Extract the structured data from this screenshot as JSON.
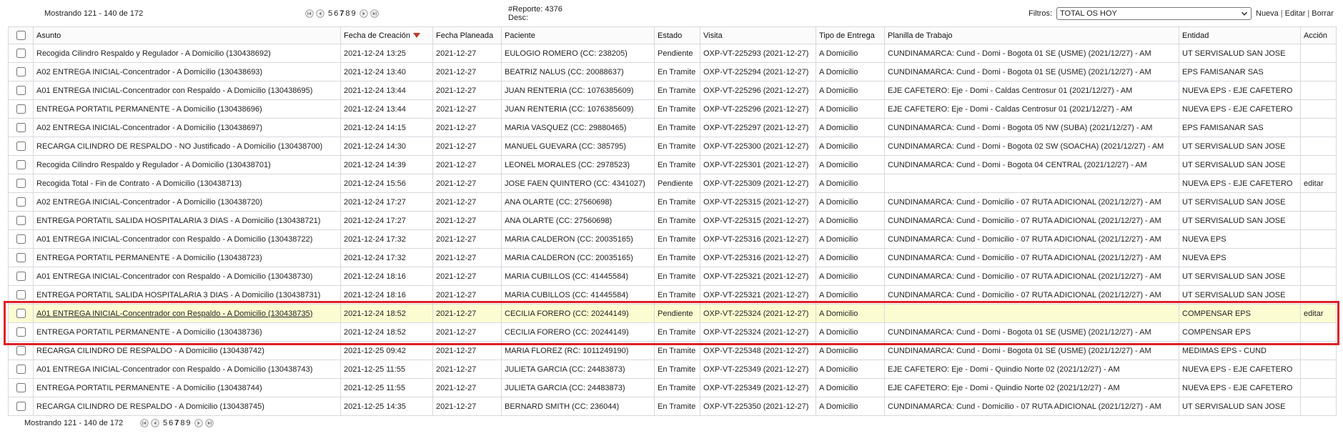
{
  "header_bar": {
    "showing_text": "Mostrando 121 - 140 de 172",
    "pages": [
      "5",
      "6",
      "7",
      "8",
      "9"
    ],
    "current_page": 7,
    "report_label": "#Reporte: 4376",
    "desc_label": "Desc:",
    "filters_label": "Filtros:",
    "filter_selected": "TOTAL OS HOY",
    "actions": [
      "Nueva",
      "Editar",
      "Borrar"
    ],
    "action_separator": "|"
  },
  "footer_bar": {
    "showing_text": "Mostrando 121 - 140 de 172",
    "pages": [
      "5",
      "6",
      "7",
      "8",
      "9"
    ],
    "current_page": 7
  },
  "icons": {
    "first": "first-page-icon",
    "previous": "previous-page-icon",
    "next": "next-page-icon",
    "last": "last-page-icon",
    "select": "chevron-down-icon",
    "sort": "sort-desc-icon"
  },
  "colors": {
    "grid_border": "#d5d8de",
    "hover_row": "#fcfcd2",
    "annotation_red": "#e02027",
    "sort_arrow": "#c0392b",
    "text": "#222222"
  },
  "table": {
    "columns": [
      "Asunto",
      "Fecha de Creación",
      "Fecha Planeada",
      "Paciente",
      "Estado",
      "Visita",
      "Tipo de Entrega",
      "Planilla de Trabajo",
      "Entidad",
      "Acción"
    ],
    "rows": [
      {
        "asunto": "Recogida Cilindro Respaldo y Regulador - A Domicilio (130438692)",
        "fecha_creacion": "2021-12-24 13:25",
        "fecha_planeada": "2021-12-27",
        "paciente": "EULOGIO ROMERO (CC: 238205)",
        "estado": "Pendiente",
        "visita": "OXP-VT-225293 (2021-12-27)",
        "tipo_entrega": "A Domicilio",
        "planilla": "CUNDINAMARCA: Cund - Domi - Bogota 01 SE (USME) (2021/12/27) - AM",
        "entidad": "UT SERVISALUD SAN JOSE",
        "accion": ""
      },
      {
        "asunto": "A02 ENTREGA INICIAL-Concentrador - A Domicilio (130438693)",
        "fecha_creacion": "2021-12-24 13:40",
        "fecha_planeada": "2021-12-27",
        "paciente": "BEATRIZ NALUS (CC: 20088637)",
        "estado": "En Tramite",
        "visita": "OXP-VT-225294 (2021-12-27)",
        "tipo_entrega": "A Domicilio",
        "planilla": "CUNDINAMARCA: Cund - Domi - Bogota 01 SE (USME) (2021/12/27) - AM",
        "entidad": "EPS FAMISANAR SAS",
        "accion": ""
      },
      {
        "asunto": "A01 ENTREGA INICIAL-Concentrador con Respaldo - A Domicilio (130438695)",
        "fecha_creacion": "2021-12-24 13:44",
        "fecha_planeada": "2021-12-27",
        "paciente": "JUAN RENTERIA (CC: 1076385609)",
        "estado": "En Tramite",
        "visita": "OXP-VT-225296 (2021-12-27)",
        "tipo_entrega": "A Domicilio",
        "planilla": "EJE CAFETERO: Eje - Domi - Caldas Centrosur 01 (2021/12/27) - AM",
        "entidad": "NUEVA EPS - EJE CAFETERO",
        "accion": ""
      },
      {
        "asunto": "ENTREGA PORTATIL PERMANENTE - A Domicilio (130438696)",
        "fecha_creacion": "2021-12-24 13:44",
        "fecha_planeada": "2021-12-27",
        "paciente": "JUAN RENTERIA (CC: 1076385609)",
        "estado": "En Tramite",
        "visita": "OXP-VT-225296 (2021-12-27)",
        "tipo_entrega": "A Domicilio",
        "planilla": "EJE CAFETERO: Eje - Domi - Caldas Centrosur 01 (2021/12/27) - AM",
        "entidad": "NUEVA EPS - EJE CAFETERO",
        "accion": ""
      },
      {
        "asunto": "A02 ENTREGA INICIAL-Concentrador - A Domicilio (130438697)",
        "fecha_creacion": "2021-12-24 14:15",
        "fecha_planeada": "2021-12-27",
        "paciente": "MARIA VASQUEZ (CC: 29880465)",
        "estado": "En Tramite",
        "visita": "OXP-VT-225297 (2021-12-27)",
        "tipo_entrega": "A Domicilio",
        "planilla": "CUNDINAMARCA: Cund - Domi - Bogota 05 NW (SUBA) (2021/12/27) - AM",
        "entidad": "EPS FAMISANAR SAS",
        "accion": ""
      },
      {
        "asunto": "RECARGA CILINDRO DE RESPALDO - NO Justificado - A Domicilio (130438700)",
        "fecha_creacion": "2021-12-24 14:30",
        "fecha_planeada": "2021-12-27",
        "paciente": "MANUEL GUEVARA (CC: 385795)",
        "estado": "En Tramite",
        "visita": "OXP-VT-225300 (2021-12-27)",
        "tipo_entrega": "A Domicilio",
        "planilla": "CUNDINAMARCA: Cund - Domi - Bogota 02 SW (SOACHA) (2021/12/27) - AM",
        "entidad": "UT SERVISALUD SAN JOSE",
        "accion": ""
      },
      {
        "asunto": "Recogida Cilindro Respaldo y Regulador - A Domicilio (130438701)",
        "fecha_creacion": "2021-12-24 14:39",
        "fecha_planeada": "2021-12-27",
        "paciente": "LEONEL MORALES (CC: 2978523)",
        "estado": "En Tramite",
        "visita": "OXP-VT-225301 (2021-12-27)",
        "tipo_entrega": "A Domicilio",
        "planilla": "CUNDINAMARCA: Cund - Domi - Bogota 04 CENTRAL (2021/12/27) - AM",
        "entidad": "UT SERVISALUD SAN JOSE",
        "accion": ""
      },
      {
        "asunto": "Recogida Total - Fin de Contrato - A Domicilio (130438713)",
        "fecha_creacion": "2021-12-24 15:56",
        "fecha_planeada": "2021-12-27",
        "paciente": "JOSE FAEN QUINTERO (CC: 4341027)",
        "estado": "Pendiente",
        "visita": "OXP-VT-225309 (2021-12-27)",
        "tipo_entrega": "A Domicilio",
        "planilla": "",
        "entidad": "NUEVA EPS - EJE CAFETERO",
        "accion": "editar"
      },
      {
        "asunto": "A02 ENTREGA INICIAL-Concentrador - A Domicilio (130438720)",
        "fecha_creacion": "2021-12-24 17:27",
        "fecha_planeada": "2021-12-27",
        "paciente": "ANA OLARTE (CC: 27560698)",
        "estado": "En Tramite",
        "visita": "OXP-VT-225315 (2021-12-27)",
        "tipo_entrega": "A Domicilio",
        "planilla": "CUNDINAMARCA: Cund - Domicilio - 07 RUTA ADICIONAL (2021/12/27) - AM",
        "entidad": "UT SERVISALUD SAN JOSE",
        "accion": ""
      },
      {
        "asunto": "ENTREGA PORTATIL SALIDA HOSPITALARIA 3 DIAS - A Domicilio (130438721)",
        "fecha_creacion": "2021-12-24 17:27",
        "fecha_planeada": "2021-12-27",
        "paciente": "ANA OLARTE (CC: 27560698)",
        "estado": "En Tramite",
        "visita": "OXP-VT-225315 (2021-12-27)",
        "tipo_entrega": "A Domicilio",
        "planilla": "CUNDINAMARCA: Cund - Domicilio - 07 RUTA ADICIONAL (2021/12/27) - AM",
        "entidad": "UT SERVISALUD SAN JOSE",
        "accion": ""
      },
      {
        "asunto": "A01 ENTREGA INICIAL-Concentrador con Respaldo - A Domicilio (130438722)",
        "fecha_creacion": "2021-12-24 17:32",
        "fecha_planeada": "2021-12-27",
        "paciente": "MARIA CALDERON (CC: 20035165)",
        "estado": "En Tramite",
        "visita": "OXP-VT-225316 (2021-12-27)",
        "tipo_entrega": "A Domicilio",
        "planilla": "CUNDINAMARCA: Cund - Domicilio - 07 RUTA ADICIONAL (2021/12/27) - AM",
        "entidad": "NUEVA EPS",
        "accion": ""
      },
      {
        "asunto": "ENTREGA PORTATIL PERMANENTE - A Domicilio (130438723)",
        "fecha_creacion": "2021-12-24 17:32",
        "fecha_planeada": "2021-12-27",
        "paciente": "MARIA CALDERON (CC: 20035165)",
        "estado": "En Tramite",
        "visita": "OXP-VT-225316 (2021-12-27)",
        "tipo_entrega": "A Domicilio",
        "planilla": "CUNDINAMARCA: Cund - Domicilio - 07 RUTA ADICIONAL (2021/12/27) - AM",
        "entidad": "NUEVA EPS",
        "accion": ""
      },
      {
        "asunto": "A01 ENTREGA INICIAL-Concentrador con Respaldo - A Domicilio (130438730)",
        "fecha_creacion": "2021-12-24 18:16",
        "fecha_planeada": "2021-12-27",
        "paciente": "MARIA CUBILLOS (CC: 41445584)",
        "estado": "En Tramite",
        "visita": "OXP-VT-225321 (2021-12-27)",
        "tipo_entrega": "A Domicilio",
        "planilla": "CUNDINAMARCA: Cund - Domicilio - 07 RUTA ADICIONAL (2021/12/27) - AM",
        "entidad": "UT SERVISALUD SAN JOSE",
        "accion": ""
      },
      {
        "asunto": "ENTREGA PORTATIL SALIDA HOSPITALARIA 3 DIAS - A Domicilio (130438731)",
        "fecha_creacion": "2021-12-24 18:16",
        "fecha_planeada": "2021-12-27",
        "paciente": "MARIA CUBILLOS (CC: 41445584)",
        "estado": "En Tramite",
        "visita": "OXP-VT-225321 (2021-12-27)",
        "tipo_entrega": "A Domicilio",
        "planilla": "CUNDINAMARCA: Cund - Domicilio - 07 RUTA ADICIONAL (2021/12/27) - AM",
        "entidad": "UT SERVISALUD SAN JOSE",
        "accion": ""
      },
      {
        "asunto": "A01 ENTREGA INICIAL-Concentrador con Respaldo - A Domicilio (130438735)",
        "fecha_creacion": "2021-12-24 18:52",
        "fecha_planeada": "2021-12-27",
        "paciente": "CECILIA FORERO (CC: 20244149)",
        "estado": "Pendiente",
        "visita": "OXP-VT-225324 (2021-12-27)",
        "tipo_entrega": "A Domicilio",
        "planilla": "",
        "entidad": "COMPENSAR EPS",
        "accion": "editar",
        "highlighted": true
      },
      {
        "asunto": "ENTREGA PORTATIL PERMANENTE - A Domicilio (130438736)",
        "fecha_creacion": "2021-12-24 18:52",
        "fecha_planeada": "2021-12-27",
        "paciente": "CECILIA FORERO (CC: 20244149)",
        "estado": "En Tramite",
        "visita": "OXP-VT-225324 (2021-12-27)",
        "tipo_entrega": "A Domicilio",
        "planilla": "CUNDINAMARCA: Cund - Domi - Bogota 01 SE (USME) (2021/12/27) - AM",
        "entidad": "COMPENSAR EPS",
        "accion": ""
      },
      {
        "asunto": "RECARGA CILINDRO DE RESPALDO - A Domicilio (130438742)",
        "fecha_creacion": "2021-12-25 09:42",
        "fecha_planeada": "2021-12-27",
        "paciente": "MARIA FLOREZ (RC: 1011249190)",
        "estado": "En Tramite",
        "visita": "OXP-VT-225348 (2021-12-27)",
        "tipo_entrega": "A Domicilio",
        "planilla": "CUNDINAMARCA: Cund - Domi - Bogota 01 SE (USME) (2021/12/27) - AM",
        "entidad": "MEDIMAS EPS - CUND",
        "accion": ""
      },
      {
        "asunto": "A01 ENTREGA INICIAL-Concentrador con Respaldo - A Domicilio (130438743)",
        "fecha_creacion": "2021-12-25 11:55",
        "fecha_planeada": "2021-12-27",
        "paciente": "JULIETA GARCIA (CC: 24483873)",
        "estado": "En Tramite",
        "visita": "OXP-VT-225349 (2021-12-27)",
        "tipo_entrega": "A Domicilio",
        "planilla": "EJE CAFETERO: Eje - Domi - Quindio Norte 02 (2021/12/27) - AM",
        "entidad": "NUEVA EPS - EJE CAFETERO",
        "accion": ""
      },
      {
        "asunto": "ENTREGA PORTATIL PERMANENTE - A Domicilio (130438744)",
        "fecha_creacion": "2021-12-25 11:55",
        "fecha_planeada": "2021-12-27",
        "paciente": "JULIETA GARCIA (CC: 24483873)",
        "estado": "En Tramite",
        "visita": "OXP-VT-225349 (2021-12-27)",
        "tipo_entrega": "A Domicilio",
        "planilla": "EJE CAFETERO: Eje - Domi - Quindio Norte 02 (2021/12/27) - AM",
        "entidad": "NUEVA EPS - EJE CAFETERO",
        "accion": ""
      },
      {
        "asunto": "RECARGA CILINDRO DE RESPALDO - A Domicilio (130438745)",
        "fecha_creacion": "2021-12-25 14:35",
        "fecha_planeada": "2021-12-27",
        "paciente": "BERNARD SMITH (CC: 236044)",
        "estado": "En Tramite",
        "visita": "OXP-VT-225350 (2021-12-27)",
        "tipo_entrega": "A Domicilio",
        "planilla": "CUNDINAMARCA: Cund - Domicilio - 07 RUTA ADICIONAL (2021/12/27) - AM",
        "entidad": "UT SERVISALUD SAN JOSE",
        "accion": ""
      }
    ]
  }
}
